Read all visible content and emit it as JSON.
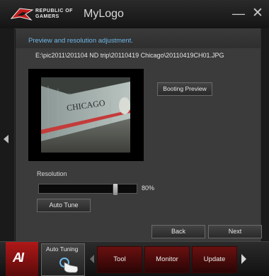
{
  "window": {
    "brand_line1": "REPUBLIC OF",
    "brand_line2": "GAMERS",
    "title": "MyLogo",
    "minimize_glyph": "—",
    "close_glyph": "✕"
  },
  "content": {
    "section_header": "Preview and resolution adjustment.",
    "file_path": "E:\\pic2011\\201104 ND trip\\20110419 Chicago\\20110419CH01.JPG",
    "photo_sign_text": "CHICAGO",
    "booting_preview_label": "Booting Preview",
    "resolution_label": "Resolution",
    "resolution_value": "80%",
    "resolution_fraction": 0.8,
    "auto_tune_button_label": "Auto Tune"
  },
  "navigation": {
    "back_label": "Back",
    "next_label": "Next"
  },
  "bottom_bar": {
    "ai_logo_text": "AI",
    "auto_tuning_label": "Auto Tuning",
    "tabs": [
      {
        "label": "Tool"
      },
      {
        "label": "Monitor"
      },
      {
        "label": "Update"
      }
    ]
  },
  "colors": {
    "accent_blue": "#6fb8ea",
    "brand_red": "#b01818",
    "tab_red": "#6a1010"
  },
  "icons": [
    "rog-eye-icon",
    "minimize-icon",
    "close-icon",
    "left-arrow-icon",
    "right-arrow-icon",
    "ai-suite-logo-icon",
    "hand-pointer-icon"
  ]
}
